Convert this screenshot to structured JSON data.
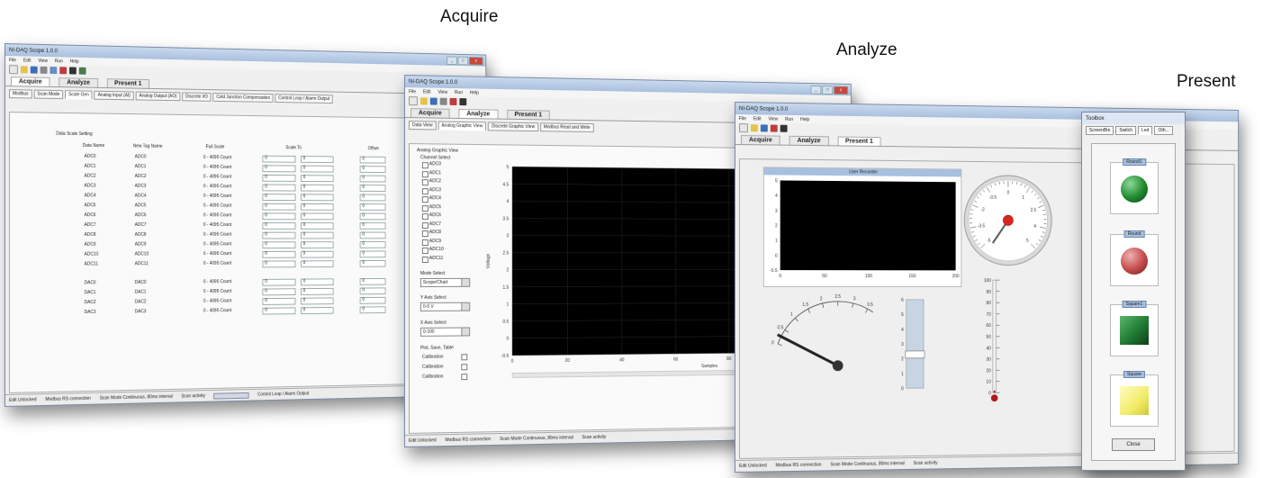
{
  "captions": {
    "acquire": "Acquire",
    "analyze": "Analyze",
    "present": "Present"
  },
  "window_title": "NI-DAQ Scope 1.0.0",
  "menu": [
    "File",
    "Edit",
    "View",
    "Run",
    "Help"
  ],
  "main_tabs": [
    "Acquire",
    "Analyze",
    "Present 1"
  ],
  "acquire": {
    "subtabs": [
      "Modbus",
      "Scan Mode",
      "Scale Gen",
      "Analog Input (AI)",
      "Analog Output (AO)",
      "Discrete I/O",
      "Cold Junction Compensation",
      "Control Loop / Alarm Output"
    ],
    "section_title": "Data Scale Setting",
    "headers": {
      "name": "Data Name",
      "tag": "New Tag Name",
      "scale": "Full Scale",
      "scaleto": "Scale To",
      "offset": "Offset"
    },
    "rows": [
      {
        "name": "ADC0",
        "tag": "ADC0",
        "scale": "0 - 4095 Count"
      },
      {
        "name": "ADC1",
        "tag": "ADC1",
        "scale": "0 - 4095 Count"
      },
      {
        "name": "ADC2",
        "tag": "ADC2",
        "scale": "0 - 4095 Count"
      },
      {
        "name": "ADC3",
        "tag": "ADC3",
        "scale": "0 - 4095 Count"
      },
      {
        "name": "ADC4",
        "tag": "ADC4",
        "scale": "0 - 4095 Count"
      },
      {
        "name": "ADC5",
        "tag": "ADC5",
        "scale": "0 - 4095 Count"
      },
      {
        "name": "ADC6",
        "tag": "ADC6",
        "scale": "0 - 4095 Count"
      },
      {
        "name": "ADC7",
        "tag": "ADC7",
        "scale": "0 - 4095 Count"
      },
      {
        "name": "ADC8",
        "tag": "ADC8",
        "scale": "0 - 4095 Count"
      },
      {
        "name": "ADC9",
        "tag": "ADC9",
        "scale": "0 - 4095 Count"
      },
      {
        "name": "ADC10",
        "tag": "ADC10",
        "scale": "0 - 4095 Count"
      },
      {
        "name": "ADC11",
        "tag": "ADC11",
        "scale": "0 - 4095 Count"
      }
    ],
    "dac_rows": [
      {
        "name": "DAC0",
        "tag": "DAC0",
        "scale": "0 - 4095 Count"
      },
      {
        "name": "DAC1",
        "tag": "DAC1",
        "scale": "0 - 4095 Count"
      },
      {
        "name": "DAC2",
        "tag": "DAC2",
        "scale": "0 - 4095 Count"
      },
      {
        "name": "DAC3",
        "tag": "DAC3",
        "scale": "0 - 4095 Count"
      }
    ],
    "input_value": "0",
    "status": [
      "Edit Unlocked",
      "Modbus RS connection",
      "Scan Mode Continuous, 80ms interval",
      "Scan activity",
      "Control Loop / Alarm Output"
    ]
  },
  "analyze": {
    "subtabs": [
      "Data View",
      "Analog Graphic View",
      "Discrete Graphic View",
      "Modbus Read and Write"
    ],
    "group_title": "Analog Graphic View",
    "channel_title": "Channel Select",
    "channels": [
      "ADC0",
      "ADC1",
      "ADC2",
      "ADC3",
      "ADC4",
      "ADC5",
      "ADC6",
      "ADC7",
      "ADC8",
      "ADC9",
      "ADC10",
      "ADC11"
    ],
    "mode_label": "Mode Select",
    "mode_value": "Scope/Chart",
    "yaxis_label": "Y Axis Select",
    "yaxis_value": "0-5 V",
    "xaxis_label": "X Axis Select",
    "xaxis_value": "0-100",
    "plot_label": "Plot, Save, Table",
    "calib": [
      "Calibration",
      "Calibration",
      "Calibration"
    ],
    "y_ticks": [
      "5",
      "4.5",
      "4",
      "3.5",
      "3",
      "2.5",
      "2",
      "1.5",
      "1",
      "0.5",
      "0",
      "-0.5"
    ],
    "x_ticks": [
      "0",
      "20",
      "40",
      "60",
      "80",
      "100",
      "120"
    ],
    "ylabel": "Voltage",
    "xlabel": "Samples",
    "status": [
      "Edit Unlocked",
      "Modbus RS connection",
      "Scan Mode Continuous, 80ms interval",
      "Scan activity"
    ]
  },
  "present": {
    "plot_title": "User Recorder",
    "y_ticks": [
      "5",
      "4",
      "3",
      "2",
      "1",
      "0",
      "-0.5"
    ],
    "x_ticks": [
      "0",
      "50",
      "100",
      "150",
      "200"
    ],
    "gauge_ticks": [
      "-5",
      "-3.5",
      "-2",
      "-0.5",
      "0",
      "1",
      "2.5",
      "4",
      "5"
    ],
    "meter_ticks": [
      "0",
      "0.5",
      "1",
      "1.5",
      "2",
      "2.5",
      "3",
      "3.5",
      "4",
      "4.5",
      "5"
    ],
    "slider_ticks": [
      "6",
      "5",
      "4",
      "3",
      "2",
      "1",
      "0"
    ],
    "thermo_ticks": [
      "100",
      "90",
      "80",
      "70",
      "60",
      "50",
      "40",
      "30",
      "20",
      "10",
      "0"
    ],
    "status": [
      "Edit Unlocked",
      "Modbus RS connection",
      "Scan Mode Continuous, 80ms interval",
      "Scan activity"
    ],
    "slider_level": 0.38,
    "thermo_level": 0.02
  },
  "panel": {
    "title": "Toolbox",
    "tabs": [
      "ScreenBtn",
      "Switch",
      "Led",
      "Oth..."
    ],
    "indicators": [
      "Round1",
      "Round",
      "Square1",
      "Square"
    ],
    "close": "Close"
  },
  "colors": {
    "led_green": "#1e8a2e",
    "led_red": "#c24b4b",
    "square_green": "#1f7a33",
    "square_yellow": "#f2ec6a",
    "plot_bg": "#000000"
  }
}
